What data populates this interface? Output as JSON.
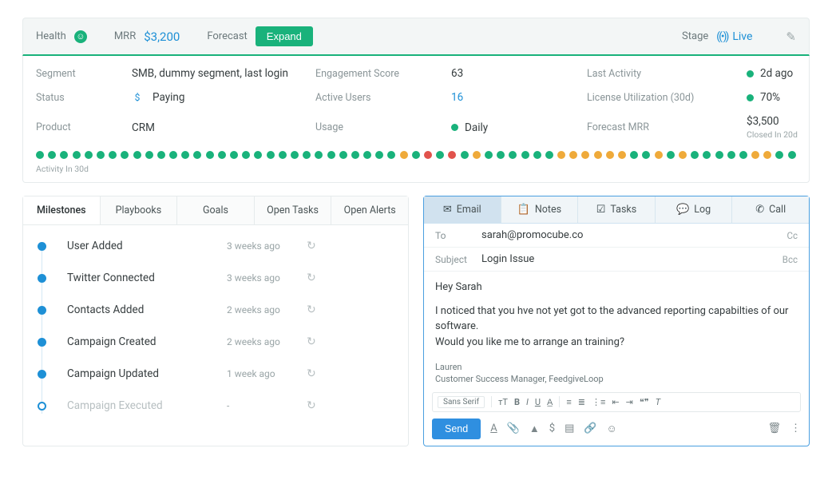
{
  "topbar": {
    "health_label": "Health",
    "mrr_label": "MRR",
    "mrr_value": "$3,200",
    "forecast_label": "Forecast",
    "expand_label": "Expand",
    "stage_label": "Stage",
    "stage_value": "Live"
  },
  "summary": {
    "segment_label": "Segment",
    "segment_value": "SMB, dummy segment, last login",
    "engagement_label": "Engagement Score",
    "engagement_value": "63",
    "lastactivity_label": "Last Activity",
    "lastactivity_value": "2d ago",
    "status_label": "Status",
    "status_value": "Paying",
    "activeusers_label": "Active Users",
    "activeusers_value": "16",
    "licenseutil_label": "License Utilization (30d)",
    "licenseutil_value": "70%",
    "product_label": "Product",
    "product_value": "CRM",
    "usage_label": "Usage",
    "usage_value": "Daily",
    "forecastmrr_label": "Forecast MRR",
    "forecastmrr_value": "$3,500",
    "forecastmrr_sub": "Closed In 20d",
    "activity_label": "Activity In 30d"
  },
  "milestone_tabs": {
    "t0": "Milestones",
    "t1": "Playbooks",
    "t2": "Goals",
    "t3": "Open Tasks",
    "t4": "Open Alerts"
  },
  "milestones": {
    "r0_name": "User Added",
    "r0_time": "3 weeks ago",
    "r1_name": "Twitter Connected",
    "r1_time": "3 weeks ago",
    "r2_name": "Contacts Added",
    "r2_time": "2 weeks ago",
    "r3_name": "Campaign Created",
    "r3_time": "2 weeks ago",
    "r4_name": "Campaign Updated",
    "r4_time": "1 week ago",
    "r5_name": "Campaign Executed",
    "r5_time": "-"
  },
  "compose_tabs": {
    "email": "Email",
    "notes": "Notes",
    "tasks": "Tasks",
    "log": "Log",
    "call": "Call"
  },
  "compose": {
    "to_label": "To",
    "to_value": "sarah@promocube.co",
    "cc_label": "Cc",
    "subject_label": "Subject",
    "subject_value": "Login Issue",
    "bcc_label": "Bcc",
    "body_greeting": "Hey Sarah",
    "body_p1": "I noticed that you hve not yet got to the advanced reporting capabilties of our software.",
    "body_p2": "Would you like me to arrange an training?",
    "sig_name": "Lauren",
    "sig_title": "Customer Success Manager, FeedgiveLoop",
    "font_label": "Sans Serif",
    "send_label": "Send"
  }
}
